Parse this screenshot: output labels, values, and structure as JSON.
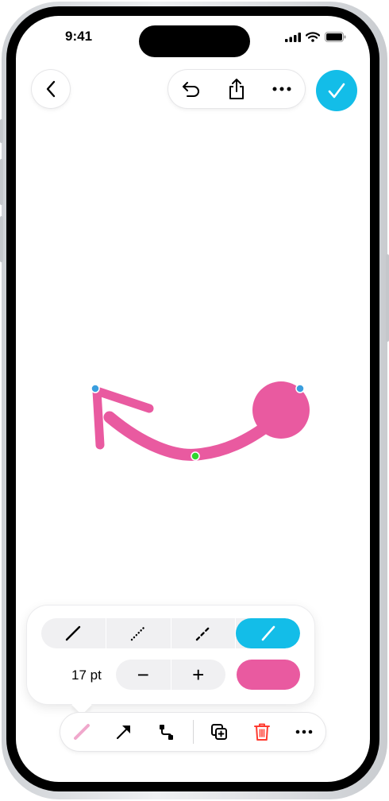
{
  "status_bar": {
    "time": "9:41"
  },
  "top_bar": {
    "back_icon": "chevron-left-icon",
    "undo_icon": "undo-icon",
    "share_icon": "share-icon",
    "more_icon": "ellipsis-icon",
    "done_icon": "checkmark-icon",
    "done_color": "#13bde8"
  },
  "canvas": {
    "shape": "curved-arrow",
    "stroke_color": "#e95aa0",
    "handle_color_endpoints": "#3a9ede",
    "handle_color_mid": "#2fd62f"
  },
  "stroke_panel": {
    "styles": [
      {
        "name": "solid-line"
      },
      {
        "name": "dotted-line"
      },
      {
        "name": "dashed-line"
      },
      {
        "name": "brush-line",
        "selected": true
      }
    ],
    "size_label": "17 pt",
    "decrement": "−",
    "increment": "+",
    "color": "#e95aa0"
  },
  "bottom_toolbar": {
    "items": [
      "stroke-style-icon",
      "arrow-icon",
      "connection-icon",
      "duplicate-icon",
      "trash-icon",
      "ellipsis-icon"
    ],
    "trash_color": "#ff3b30"
  }
}
